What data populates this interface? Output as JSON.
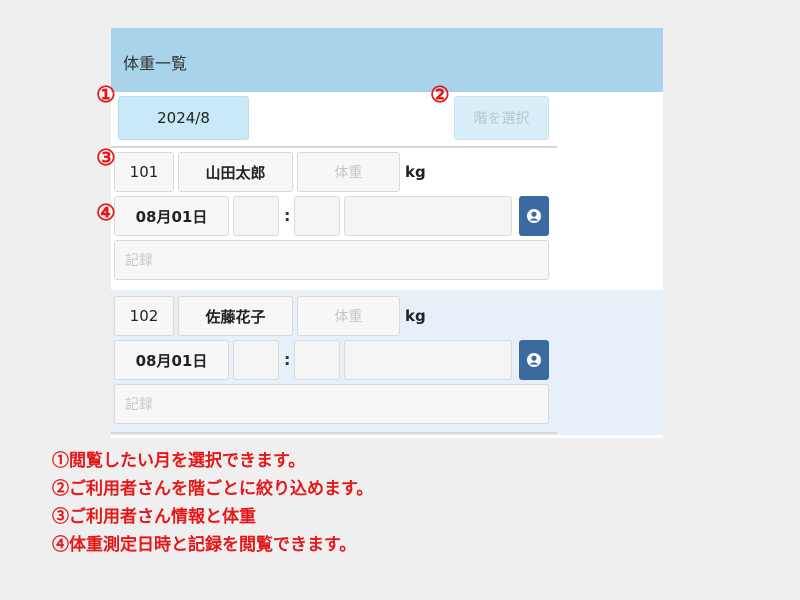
{
  "header": {
    "title": "体重一覧"
  },
  "controls": {
    "month": "2024/8",
    "floor_button": "階を選択"
  },
  "markers": [
    "①",
    "②",
    "③",
    "④"
  ],
  "records": [
    {
      "room": "101",
      "name": "山田太郎",
      "weight_placeholder": "体重",
      "unit": "kg",
      "date": "08月01日",
      "colon": ":",
      "record_placeholder": "記録"
    },
    {
      "room": "102",
      "name": "佐藤花子",
      "weight_placeholder": "体重",
      "unit": "kg",
      "date": "08月01日",
      "colon": ":",
      "record_placeholder": "記録"
    }
  ],
  "notes": [
    "①閲覧したい月を選択できます。",
    "②ご利用者さんを階ごとに絞り込めます。",
    "③ご利用者さん情報と体重",
    "④体重測定日時と記録を閲覧できます。"
  ],
  "colors": {
    "header_bg": "#a8d3ea",
    "annotation_red": "#e41818",
    "icon_button": "#3a6aa0",
    "row_alt_bg": "#e7f0f8"
  },
  "icons": {
    "record_button": "person-badge-icon"
  }
}
